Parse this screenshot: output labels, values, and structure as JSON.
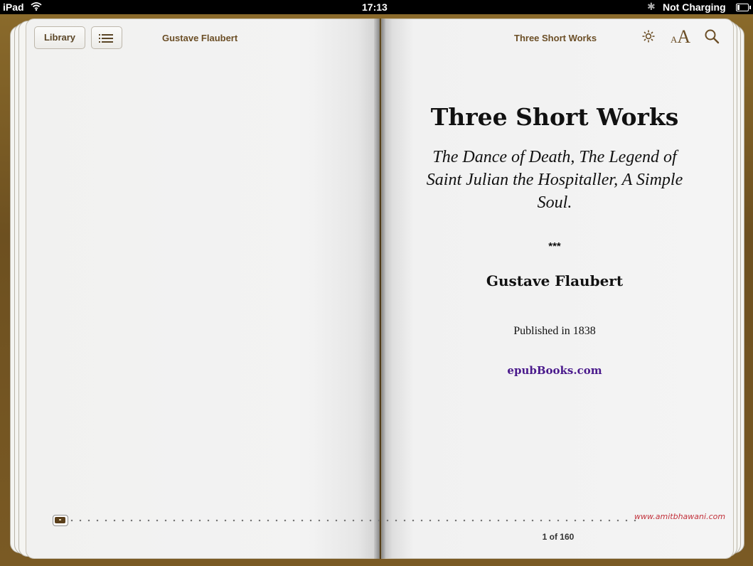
{
  "status_bar": {
    "device": "iPad",
    "wifi_icon": "wifi-icon",
    "time": "17:13",
    "bluetooth_icon": "bluetooth-icon",
    "charging": "Not Charging",
    "battery_icon": "battery-icon"
  },
  "toolbar": {
    "library_label": "Library",
    "toc_icon": "list-icon",
    "left_header": "Gustave Flaubert",
    "right_header": "Three Short Works",
    "brightness_icon": "sun-icon",
    "font_small": "A",
    "font_large": "A",
    "search_icon": "magnifier-icon"
  },
  "content": {
    "title": "Three Short Works",
    "subtitle_line1": "The Dance of Death, The Legend of",
    "subtitle_line2": "Saint Julian the Hospitaller, A Simple",
    "subtitle_line3": "Soul.",
    "separator": "***",
    "author": "Gustave Flaubert",
    "published": "Published in 1838",
    "publisher": "epubBooks.com"
  },
  "footer": {
    "watermark": "www.amitbhawani.com",
    "page_indicator": "1 of 160",
    "current_page": 1,
    "total_pages": 160
  },
  "colors": {
    "accent_brown": "#6b4e26",
    "publisher_link": "#4a1a8c",
    "watermark": "#c2303a"
  }
}
